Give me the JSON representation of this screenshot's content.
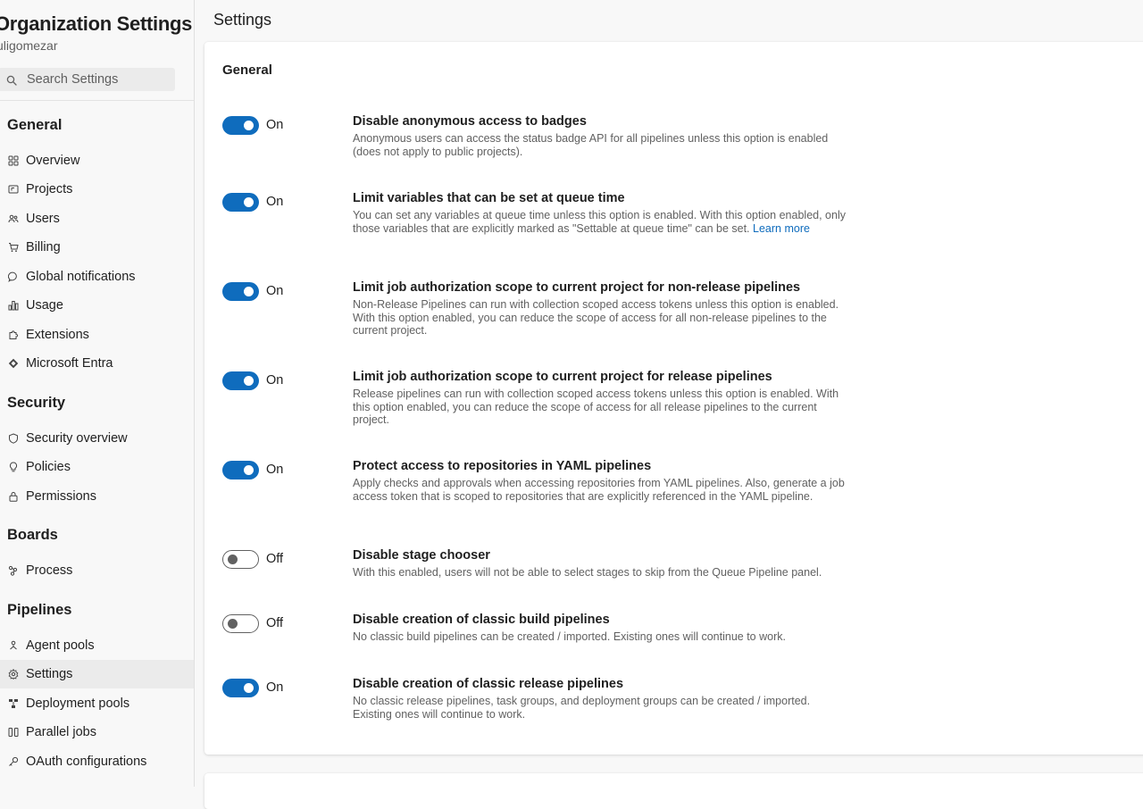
{
  "sidebar": {
    "org_title": "Organization Settings",
    "org_subtitle": "uligomezar",
    "search_placeholder": "Search Settings",
    "sections": [
      {
        "heading": "General",
        "items": [
          {
            "label": "Overview",
            "icon": "overview-icon"
          },
          {
            "label": "Projects",
            "icon": "projects-icon"
          },
          {
            "label": "Users",
            "icon": "users-icon"
          },
          {
            "label": "Billing",
            "icon": "cart-icon"
          },
          {
            "label": "Global notifications",
            "icon": "chat-icon"
          },
          {
            "label": "Usage",
            "icon": "usage-icon"
          },
          {
            "label": "Extensions",
            "icon": "puzzle-icon"
          },
          {
            "label": "Microsoft Entra",
            "icon": "entra-icon"
          }
        ]
      },
      {
        "heading": "Security",
        "items": [
          {
            "label": "Security overview",
            "icon": "shield-icon"
          },
          {
            "label": "Policies",
            "icon": "lightbulb-icon"
          },
          {
            "label": "Permissions",
            "icon": "lock-icon"
          }
        ]
      },
      {
        "heading": "Boards",
        "items": [
          {
            "label": "Process",
            "icon": "process-icon"
          }
        ]
      },
      {
        "heading": "Pipelines",
        "items": [
          {
            "label": "Agent pools",
            "icon": "agent-pools-icon"
          },
          {
            "label": "Settings",
            "icon": "gear-icon",
            "selected": true
          },
          {
            "label": "Deployment pools",
            "icon": "deployment-icon"
          },
          {
            "label": "Parallel jobs",
            "icon": "parallel-icon"
          },
          {
            "label": "OAuth configurations",
            "icon": "key-icon"
          }
        ]
      }
    ]
  },
  "main": {
    "title": "Settings",
    "card_heading": "General",
    "settings": [
      {
        "enabled": true,
        "state_label": "On",
        "title": "Disable anonymous access to badges",
        "description": "Anonymous users can access the status badge API for all pipelines unless this option is enabled (does not apply to public projects)."
      },
      {
        "enabled": true,
        "state_label": "On",
        "title": "Limit variables that can be set at queue time",
        "description": "You can set any variables at queue time unless this option is enabled. With this option enabled, only those variables that are explicitly marked as \"Settable at queue time\" can be set.",
        "link": "Learn more"
      },
      {
        "enabled": true,
        "state_label": "On",
        "title": "Limit job authorization scope to current project for non-release pipelines",
        "description": "Non-Release Pipelines can run with collection scoped access tokens unless this option is enabled. With this option enabled, you can reduce the scope of access for all non-release pipelines to the current project."
      },
      {
        "enabled": true,
        "state_label": "On",
        "title": "Limit job authorization scope to current project for release pipelines",
        "description": "Release pipelines can run with collection scoped access tokens unless this option is enabled. With this option enabled, you can reduce the scope of access for all release pipelines to the current project."
      },
      {
        "enabled": true,
        "state_label": "On",
        "title": "Protect access to repositories in YAML pipelines",
        "description": "Apply checks and approvals when accessing repositories from YAML pipelines. Also, generate a job access token that is scoped to repositories that are explicitly referenced in the YAML pipeline."
      },
      {
        "enabled": false,
        "state_label": "Off",
        "title": "Disable stage chooser",
        "description": "With this enabled, users will not be able to select stages to skip from the Queue Pipeline panel."
      },
      {
        "enabled": false,
        "state_label": "Off",
        "title": "Disable creation of classic build pipelines",
        "description": "No classic build pipelines can be created / imported. Existing ones will continue to work."
      },
      {
        "enabled": true,
        "state_label": "On",
        "title": "Disable creation of classic release pipelines",
        "description": "No classic release pipelines, task groups, and deployment groups can be created / imported. Existing ones will continue to work."
      }
    ]
  },
  "colors": {
    "accent": "#0f6cbd",
    "toggle_off_border": "#616161",
    "selected_bg": "#ebebeb"
  }
}
